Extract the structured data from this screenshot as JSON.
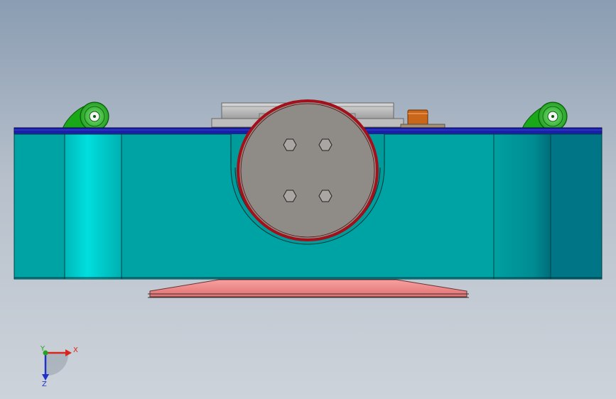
{
  "triad": {
    "x_label": "X",
    "y_label": "Y",
    "z_label": "Z",
    "x_color": "#d9261c",
    "y_color": "#23a323",
    "z_color": "#1f33c9"
  },
  "colors": {
    "body_teal": "#00a3a3",
    "body_light": "#00d1d1",
    "body_dark": "#006f7c",
    "top_rail": "#1a1fa8",
    "drum_grey": "#8f8b86",
    "drum_rim": "#a3101a",
    "wheel_green": "#1fb31f",
    "base_plate": "#f08a8a",
    "motor_orange": "#c8661a"
  }
}
